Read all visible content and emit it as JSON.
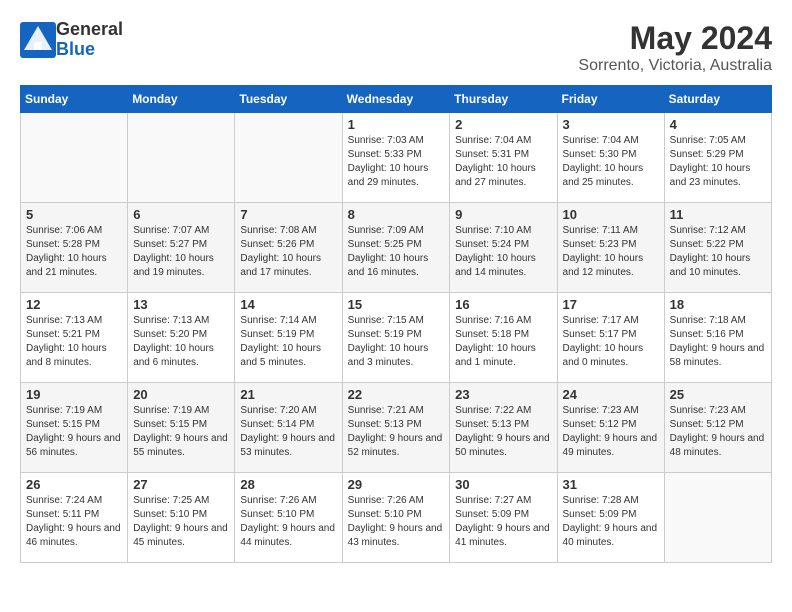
{
  "logo": {
    "line1": "General",
    "line2": "Blue"
  },
  "title": "May 2024",
  "location": "Sorrento, Victoria, Australia",
  "days_of_week": [
    "Sunday",
    "Monday",
    "Tuesday",
    "Wednesday",
    "Thursday",
    "Friday",
    "Saturday"
  ],
  "weeks": [
    [
      {
        "day": "",
        "sunrise": "",
        "sunset": "",
        "daylight": ""
      },
      {
        "day": "",
        "sunrise": "",
        "sunset": "",
        "daylight": ""
      },
      {
        "day": "",
        "sunrise": "",
        "sunset": "",
        "daylight": ""
      },
      {
        "day": "1",
        "sunrise": "Sunrise: 7:03 AM",
        "sunset": "Sunset: 5:33 PM",
        "daylight": "Daylight: 10 hours and 29 minutes."
      },
      {
        "day": "2",
        "sunrise": "Sunrise: 7:04 AM",
        "sunset": "Sunset: 5:31 PM",
        "daylight": "Daylight: 10 hours and 27 minutes."
      },
      {
        "day": "3",
        "sunrise": "Sunrise: 7:04 AM",
        "sunset": "Sunset: 5:30 PM",
        "daylight": "Daylight: 10 hours and 25 minutes."
      },
      {
        "day": "4",
        "sunrise": "Sunrise: 7:05 AM",
        "sunset": "Sunset: 5:29 PM",
        "daylight": "Daylight: 10 hours and 23 minutes."
      }
    ],
    [
      {
        "day": "5",
        "sunrise": "Sunrise: 7:06 AM",
        "sunset": "Sunset: 5:28 PM",
        "daylight": "Daylight: 10 hours and 21 minutes."
      },
      {
        "day": "6",
        "sunrise": "Sunrise: 7:07 AM",
        "sunset": "Sunset: 5:27 PM",
        "daylight": "Daylight: 10 hours and 19 minutes."
      },
      {
        "day": "7",
        "sunrise": "Sunrise: 7:08 AM",
        "sunset": "Sunset: 5:26 PM",
        "daylight": "Daylight: 10 hours and 17 minutes."
      },
      {
        "day": "8",
        "sunrise": "Sunrise: 7:09 AM",
        "sunset": "Sunset: 5:25 PM",
        "daylight": "Daylight: 10 hours and 16 minutes."
      },
      {
        "day": "9",
        "sunrise": "Sunrise: 7:10 AM",
        "sunset": "Sunset: 5:24 PM",
        "daylight": "Daylight: 10 hours and 14 minutes."
      },
      {
        "day": "10",
        "sunrise": "Sunrise: 7:11 AM",
        "sunset": "Sunset: 5:23 PM",
        "daylight": "Daylight: 10 hours and 12 minutes."
      },
      {
        "day": "11",
        "sunrise": "Sunrise: 7:12 AM",
        "sunset": "Sunset: 5:22 PM",
        "daylight": "Daylight: 10 hours and 10 minutes."
      }
    ],
    [
      {
        "day": "12",
        "sunrise": "Sunrise: 7:13 AM",
        "sunset": "Sunset: 5:21 PM",
        "daylight": "Daylight: 10 hours and 8 minutes."
      },
      {
        "day": "13",
        "sunrise": "Sunrise: 7:13 AM",
        "sunset": "Sunset: 5:20 PM",
        "daylight": "Daylight: 10 hours and 6 minutes."
      },
      {
        "day": "14",
        "sunrise": "Sunrise: 7:14 AM",
        "sunset": "Sunset: 5:19 PM",
        "daylight": "Daylight: 10 hours and 5 minutes."
      },
      {
        "day": "15",
        "sunrise": "Sunrise: 7:15 AM",
        "sunset": "Sunset: 5:19 PM",
        "daylight": "Daylight: 10 hours and 3 minutes."
      },
      {
        "day": "16",
        "sunrise": "Sunrise: 7:16 AM",
        "sunset": "Sunset: 5:18 PM",
        "daylight": "Daylight: 10 hours and 1 minute."
      },
      {
        "day": "17",
        "sunrise": "Sunrise: 7:17 AM",
        "sunset": "Sunset: 5:17 PM",
        "daylight": "Daylight: 10 hours and 0 minutes."
      },
      {
        "day": "18",
        "sunrise": "Sunrise: 7:18 AM",
        "sunset": "Sunset: 5:16 PM",
        "daylight": "Daylight: 9 hours and 58 minutes."
      }
    ],
    [
      {
        "day": "19",
        "sunrise": "Sunrise: 7:19 AM",
        "sunset": "Sunset: 5:15 PM",
        "daylight": "Daylight: 9 hours and 56 minutes."
      },
      {
        "day": "20",
        "sunrise": "Sunrise: 7:19 AM",
        "sunset": "Sunset: 5:15 PM",
        "daylight": "Daylight: 9 hours and 55 minutes."
      },
      {
        "day": "21",
        "sunrise": "Sunrise: 7:20 AM",
        "sunset": "Sunset: 5:14 PM",
        "daylight": "Daylight: 9 hours and 53 minutes."
      },
      {
        "day": "22",
        "sunrise": "Sunrise: 7:21 AM",
        "sunset": "Sunset: 5:13 PM",
        "daylight": "Daylight: 9 hours and 52 minutes."
      },
      {
        "day": "23",
        "sunrise": "Sunrise: 7:22 AM",
        "sunset": "Sunset: 5:13 PM",
        "daylight": "Daylight: 9 hours and 50 minutes."
      },
      {
        "day": "24",
        "sunrise": "Sunrise: 7:23 AM",
        "sunset": "Sunset: 5:12 PM",
        "daylight": "Daylight: 9 hours and 49 minutes."
      },
      {
        "day": "25",
        "sunrise": "Sunrise: 7:23 AM",
        "sunset": "Sunset: 5:12 PM",
        "daylight": "Daylight: 9 hours and 48 minutes."
      }
    ],
    [
      {
        "day": "26",
        "sunrise": "Sunrise: 7:24 AM",
        "sunset": "Sunset: 5:11 PM",
        "daylight": "Daylight: 9 hours and 46 minutes."
      },
      {
        "day": "27",
        "sunrise": "Sunrise: 7:25 AM",
        "sunset": "Sunset: 5:10 PM",
        "daylight": "Daylight: 9 hours and 45 minutes."
      },
      {
        "day": "28",
        "sunrise": "Sunrise: 7:26 AM",
        "sunset": "Sunset: 5:10 PM",
        "daylight": "Daylight: 9 hours and 44 minutes."
      },
      {
        "day": "29",
        "sunrise": "Sunrise: 7:26 AM",
        "sunset": "Sunset: 5:10 PM",
        "daylight": "Daylight: 9 hours and 43 minutes."
      },
      {
        "day": "30",
        "sunrise": "Sunrise: 7:27 AM",
        "sunset": "Sunset: 5:09 PM",
        "daylight": "Daylight: 9 hours and 41 minutes."
      },
      {
        "day": "31",
        "sunrise": "Sunrise: 7:28 AM",
        "sunset": "Sunset: 5:09 PM",
        "daylight": "Daylight: 9 hours and 40 minutes."
      },
      {
        "day": "",
        "sunrise": "",
        "sunset": "",
        "daylight": ""
      }
    ]
  ]
}
